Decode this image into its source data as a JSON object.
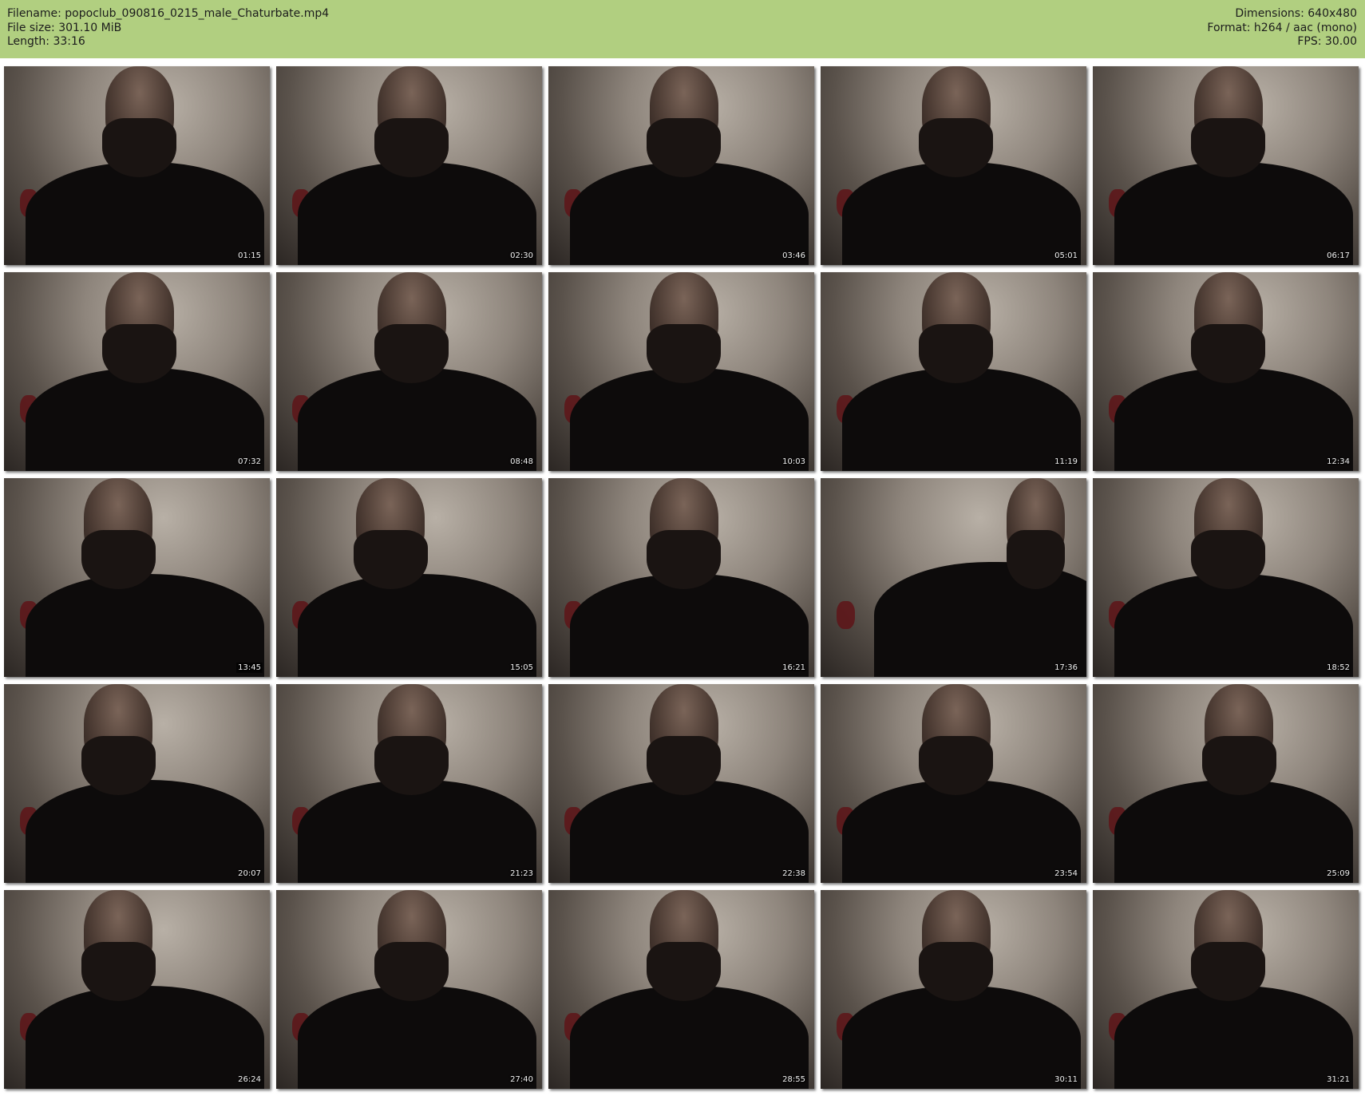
{
  "header": {
    "left": [
      "Filename: popoclub_090816_0215_male_Chaturbate.mp4",
      "File size: 301.10 MiB",
      "Length: 33:16"
    ],
    "right": [
      "Dimensions: 640x480",
      "Format: h264 / aac (mono)",
      "FPS: 30.00"
    ],
    "background_color": "#b1cf80"
  },
  "thumbnails": [
    {
      "timestamp": "01:15"
    },
    {
      "timestamp": "02:30"
    },
    {
      "timestamp": "03:46"
    },
    {
      "timestamp": "05:01"
    },
    {
      "timestamp": "06:17"
    },
    {
      "timestamp": "07:32"
    },
    {
      "timestamp": "08:48"
    },
    {
      "timestamp": "10:03"
    },
    {
      "timestamp": "11:19"
    },
    {
      "timestamp": "12:34"
    },
    {
      "timestamp": "13:45"
    },
    {
      "timestamp": "15:05"
    },
    {
      "timestamp": "16:21"
    },
    {
      "timestamp": "17:36"
    },
    {
      "timestamp": "18:52"
    },
    {
      "timestamp": "20:07"
    },
    {
      "timestamp": "21:23"
    },
    {
      "timestamp": "22:38"
    },
    {
      "timestamp": "23:54"
    },
    {
      "timestamp": "25:09"
    },
    {
      "timestamp": "26:24"
    },
    {
      "timestamp": "27:40"
    },
    {
      "timestamp": "28:55"
    },
    {
      "timestamp": "30:11"
    },
    {
      "timestamp": "31:21"
    }
  ]
}
